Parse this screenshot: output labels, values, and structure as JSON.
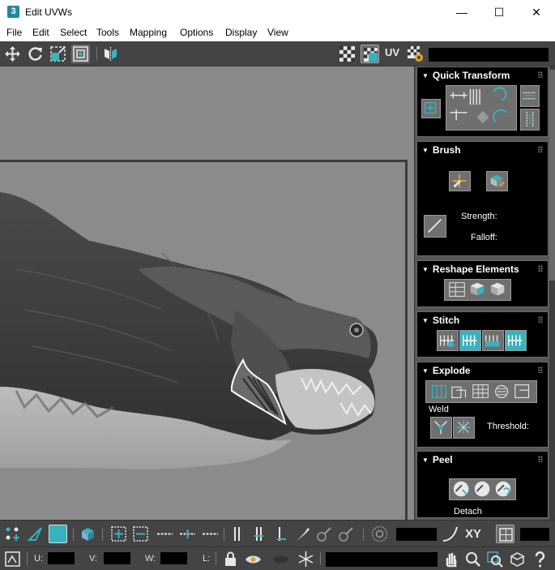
{
  "window": {
    "app_icon": "3",
    "title": "Edit UVWs",
    "minimize": "—",
    "maximize": "☐",
    "close": "✕"
  },
  "menu": [
    "File",
    "Edit",
    "Select",
    "Tools",
    "Mapping",
    "Options",
    "Display",
    "View"
  ],
  "toolbar_top": {
    "uv_label": "UV"
  },
  "rollouts": {
    "quick_transform": {
      "title": "Quick Transform"
    },
    "brush": {
      "title": "Brush",
      "strength_label": "Strength:",
      "falloff_label": "Falloff:"
    },
    "reshape": {
      "title": "Reshape Elements"
    },
    "stitch": {
      "title": "Stitch"
    },
    "explode": {
      "title": "Explode",
      "weld_label": "Weld",
      "threshold_label": "Threshold:"
    },
    "peel": {
      "title": "Peel",
      "detach_label": "Detach"
    }
  },
  "bottom_toolbar": {
    "xy_label": "XY",
    "u_label": "U:",
    "v_label": "V:",
    "w_label": "W:",
    "l_label": "L:"
  },
  "colors": {
    "accent_teal": "#37b3bd",
    "toolbar_bg": "#444444",
    "panel_bg": "#575757"
  }
}
